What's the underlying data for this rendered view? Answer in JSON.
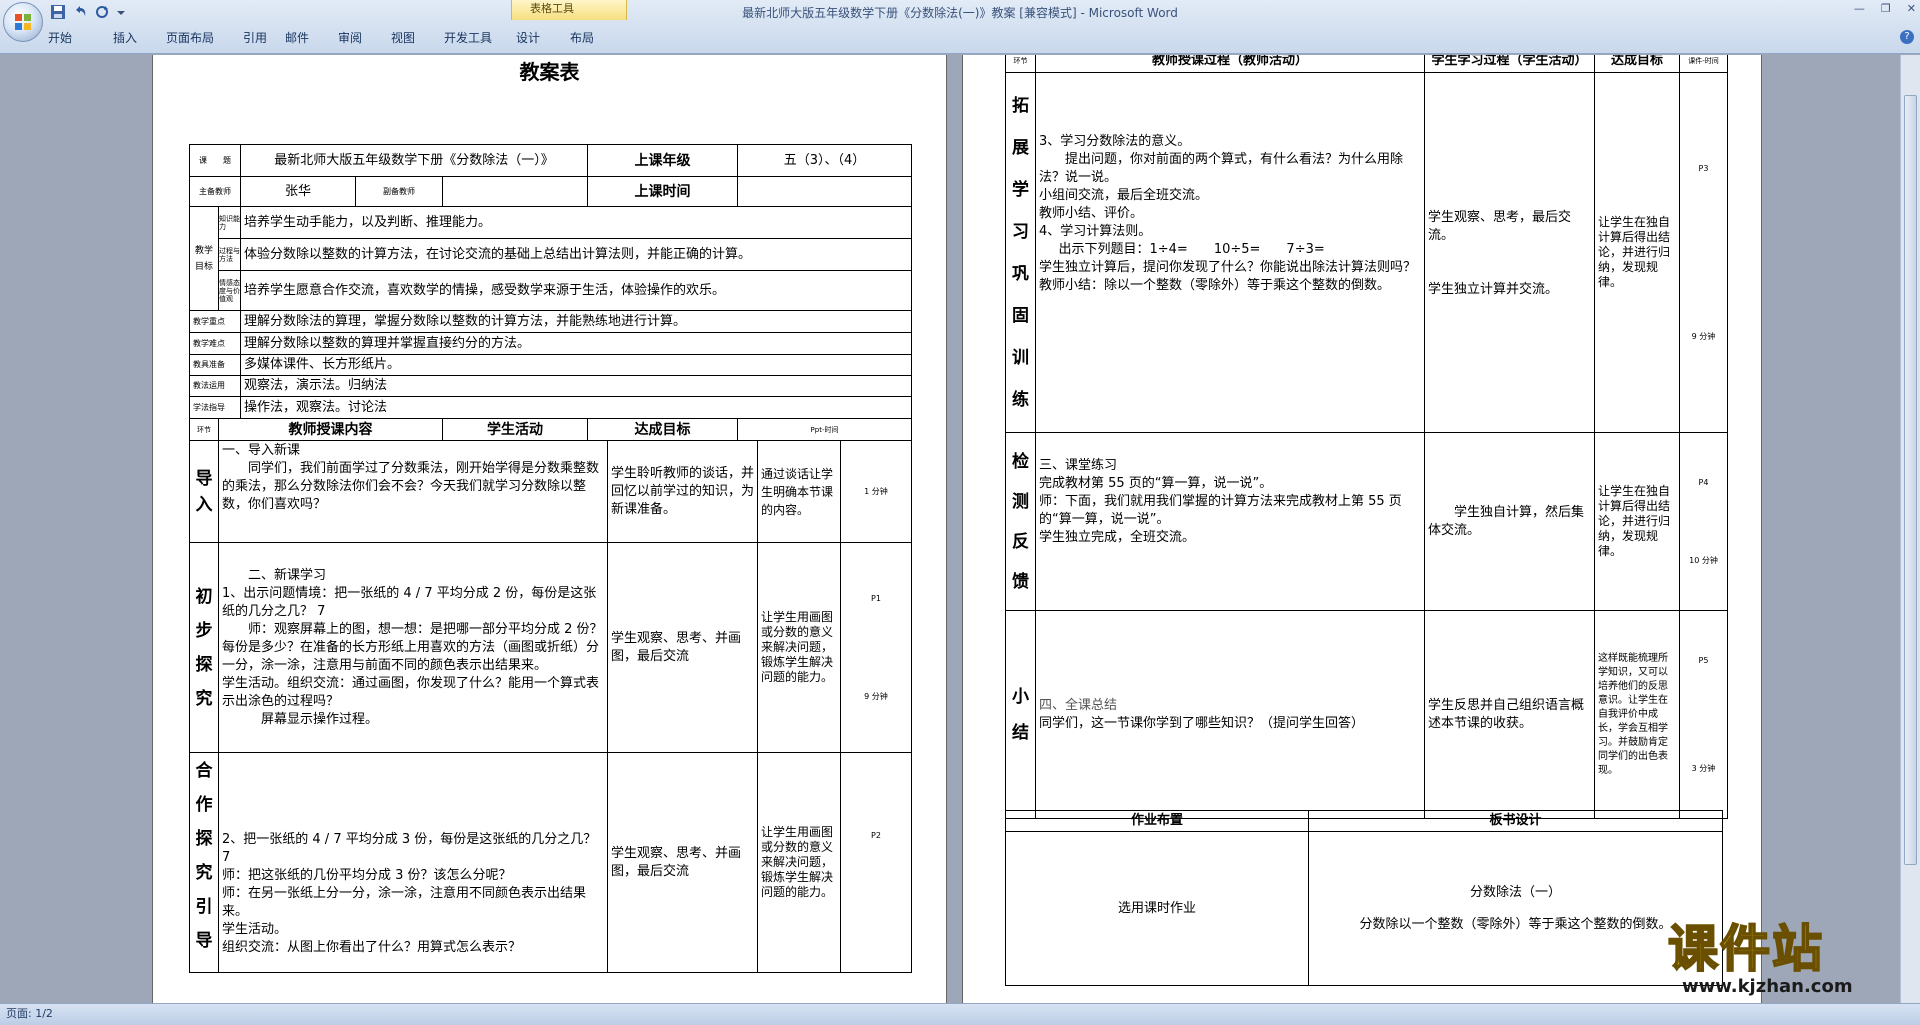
{
  "window": {
    "title": "最新北师大版五年级数学下册《分数除法(一)》教案 [兼容模式] - Microsoft Word",
    "context_tab": "表格工具"
  },
  "tabs": [
    "开始",
    "插入",
    "页面布局",
    "引用",
    "邮件",
    "审阅",
    "视图",
    "开发工具",
    "设计",
    "布局"
  ],
  "status": {
    "page": "页面: 1/2"
  },
  "watermark": {
    "text": "课件站",
    "url": "www.kjzhan.com"
  },
  "page1": {
    "heading": "教案表",
    "r1": {
      "k1": "课　　题",
      "v1": "最新北师大版五年级数学下册《分数除法（一）》",
      "k2": "上课年级",
      "v2": "五（3）、（4）"
    },
    "r2": {
      "k1": "主备教师",
      "v1": "张华",
      "k2": "副备教师",
      "v2": "",
      "k3": "上课时间",
      "v3": ""
    },
    "goals_label": "教学目标",
    "goals": [
      {
        "k": "知识能力",
        "v": "培养学生动手能力，以及判断、推理能力。"
      },
      {
        "k": "过程与方法",
        "v": "体验分数除以整数的计算方法，在讨论交流的基础上总结出计算法则，并能正确的计算。"
      },
      {
        "k": "情感态度与价值观",
        "v": "培养学生愿意合作交流，喜欢数学的情操，感受数学来源于生活，体验操作的欢乐。"
      }
    ],
    "rows": [
      {
        "k": "教学重点",
        "v": "理解分数除法的算理，掌握分数除以整数的计算方法，并能熟练地进行计算。"
      },
      {
        "k": "教学难点",
        "v": "理解分数除以整数的算理并掌握直接约分的方法。"
      },
      {
        "k": "教具准备",
        "v": "多媒体课件、长方形纸片。"
      },
      {
        "k": "教法运用",
        "v": "观察法，演示法。归纳法"
      },
      {
        "k": "学法指导",
        "v": "操作法，观察法。讨论法"
      }
    ],
    "head": {
      "seg": "环节",
      "teacher": "教师授课内容",
      "student": "学生活动",
      "goal": "达成目标",
      "pt": "Ppt-时间"
    },
    "s1": {
      "label": "导入",
      "t1": "一、导入新课",
      "t2": "同学们，我们前面学过了分数乘法，刚开始学得是分数乘整数的乘法，那么分数除法你们会不会？今天我们就学习分数除以整数，你们喜欢吗？",
      "st": "学生聆听教师的谈话，并回忆以前学过的知识，为新课准备。",
      "g": "通过谈话让学生明确本节课的内容。",
      "t": "1 分钟"
    },
    "s2": {
      "label": "初步探究",
      "t1": "二、新课学习",
      "t2": "1、出示问题情境：把一张纸的 4 / 7 平均分成 2 份，每份是这张纸的几分之几？ 7",
      "t3": "师：观察屏幕上的图，想一想：是把哪一部分平均分成 2 份？每份是多少？在准备的长方形纸上用喜欢的方法（画图或折纸）分一分，涂一涂，注意用与前面不同的颜色表示出结果来。",
      "t4": "学生活动。组织交流：通过画图，你发现了什么？能用一个算式表示出涂色的过程吗？",
      "t5": "屏幕显示操作过程。",
      "st": "学生观察、思考、并画图，最后交流",
      "g": "让学生用画图或分数的意义来解决问题，锻炼学生解决问题的能力。",
      "p": "P1",
      "t": "9 分钟"
    },
    "s3": {
      "label": "合作探究引导",
      "t1": "2、把一张纸的 4 / 7 平均分成 3 份，每份是这张纸的几分之几？ 7",
      "t2": "师：把这张纸的几份平均分成 3 份？该怎么分呢？",
      "t3": "师：在另一张纸上分一分，涂一涂，注意用不同颜色表示出结果来。",
      "t4": "学生活动。",
      "t5": "组织交流：从图上你看出了什么？用算式怎么表示？",
      "st": "学生观察、思考、并画图，最后交流",
      "g": "让学生用画图或分数的意义来解决问题，锻炼学生解决问题的能力。",
      "p": "P2"
    }
  },
  "page2": {
    "head": {
      "seg": "环节",
      "teacher": "教师授课过程（教师活动）",
      "student": "学生学习过程（学生活动）",
      "goal": "达成目标",
      "pt": "课件-时间"
    },
    "s1": {
      "label": "拓展学习巩固训练",
      "t1": "3、学习分数除法的意义。",
      "t2": "提出问题，你对前面的两个算式，有什么看法？为什么用除法？说一说。",
      "t3": "小组间交流，最后全班交流。",
      "t4": "教师小结、评价。",
      "t5": "4、学习计算法则。",
      "t6": "出示下列题目：1÷4=　　10÷5=　　7÷3=",
      "t7": "学生独立计算后，提问你发现了什么？你能说出除法计算法则吗？",
      "t8": "教师小结：除以一个整数（零除外）等于乘这个整数的倒数。",
      "st1": "学生观察、思考，最后交流。",
      "st2": "学生独立计算并交流。",
      "g": "让学生在独自计算后得出结论，并进行归纳，发现规律。",
      "p": "P3",
      "t": "9 分钟"
    },
    "s2": {
      "label": "检测反馈",
      "t1": "三、课堂练习",
      "t2": "完成教材第 55 页的“算一算，说一说”。",
      "t3": "师：下面，我们就用我们掌握的计算方法来完成教材上第 55 页的“算一算，说一说”。",
      "t4": "学生独立完成，全班交流。",
      "st": "学生独自计算，然后集体交流。",
      "g": "让学生在独自计算后得出结论，并进行归纳，发现规律。",
      "p": "P4",
      "t": "10 分钟"
    },
    "s3": {
      "label": "小结",
      "t1": "四、全课总结",
      "t2": "同学们，这一节课你学到了哪些知识？（提问学生回答）",
      "st": "学生反思并自己组织语言概述本节课的收获。",
      "g": "这样既能梳理所学知识，又可以培养他们的反思意识。让学生在自我评价中成长，学会互相学习。并鼓励肯定同学们的出色表现。",
      "p": "P5",
      "t": "3 分钟"
    },
    "hw": {
      "k": "作业布置",
      "v": "选用课时作业"
    },
    "board": {
      "k": "板书设计",
      "v1": "分数除法（一）",
      "v2": "分数除以一个整数（零除外）等于乘这个整数的倒数。"
    }
  }
}
